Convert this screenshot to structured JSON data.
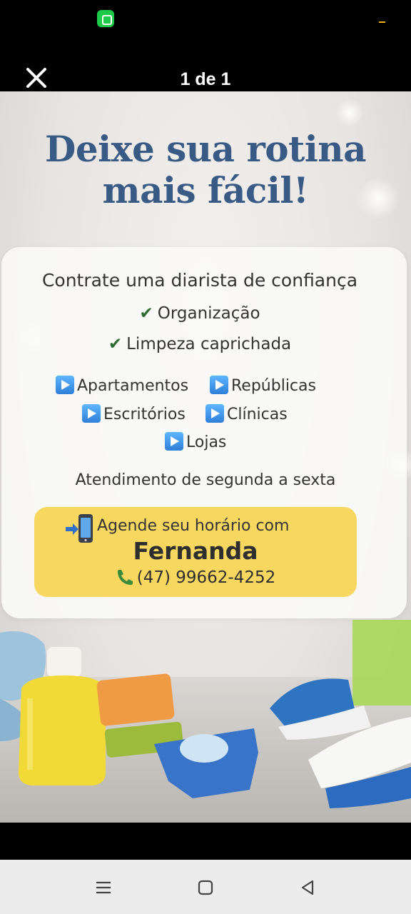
{
  "viewer": {
    "page_counter": "1 de 1"
  },
  "flyer": {
    "headline_line1": "Deixe sua rotina",
    "headline_line2": "mais fácil!",
    "subhead": "Contrate uma diarista de confiança",
    "checks": [
      "Organização",
      "Limpeza caprichada"
    ],
    "check_symbol": "✔",
    "services": [
      "Apartamentos",
      "Repúblicas",
      "Escritórios",
      "Clínicas",
      "Lojas"
    ],
    "hours": "Atendimento de segunda a sexta",
    "cta": {
      "line1": "Agende seu horário com",
      "name": "Fernanda",
      "phone": "(47) 99662-4252"
    }
  },
  "nav": {
    "buttons": [
      "menu-icon",
      "home-icon",
      "back-icon"
    ]
  },
  "colors": {
    "headline": "#3a5a86",
    "cta_background": "#f8d760",
    "check": "#2c6a2f",
    "status_app_icon": "#1ec94a"
  }
}
